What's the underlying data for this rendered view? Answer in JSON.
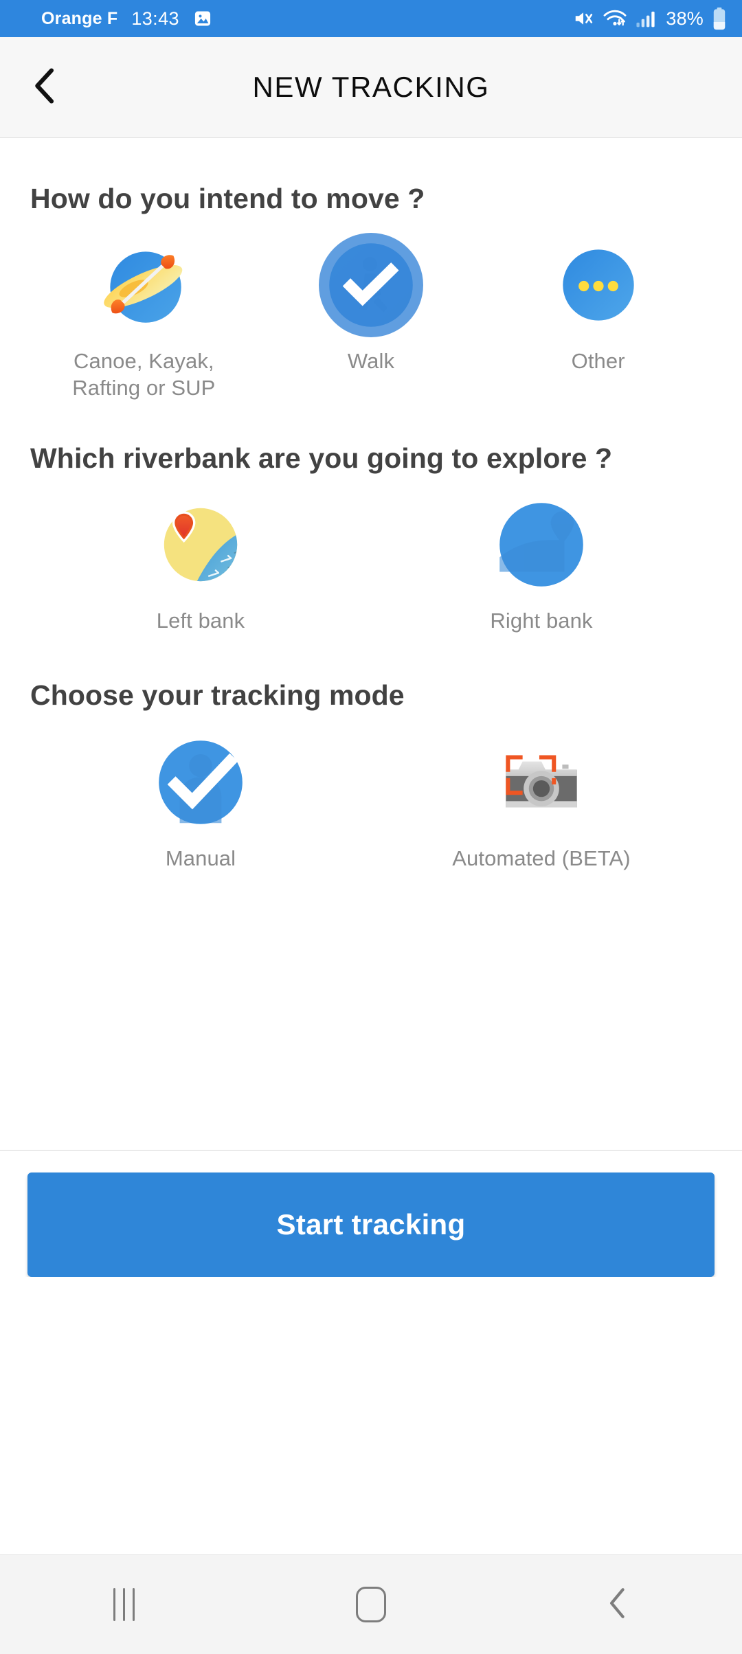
{
  "status_bar": {
    "carrier": "Orange F",
    "time": "13:43",
    "battery_percent": "38%",
    "icons": [
      "screenshot-image-icon",
      "mute-icon",
      "wifi-icon",
      "cellular-signal-icon",
      "battery-icon"
    ],
    "background_color": "#2e86de"
  },
  "appbar": {
    "title": "NEW TRACKING",
    "back_icon": "chevron-left-icon",
    "background_color": "#f7f7f7"
  },
  "sections": {
    "move": {
      "title": "How do you intend to move ?",
      "options": [
        {
          "label": "Canoe, Kayak, Rafting or SUP",
          "icon": "kayak-icon",
          "selected": false
        },
        {
          "label": "Walk",
          "icon": "walk-icon",
          "selected": true
        },
        {
          "label": "Other",
          "icon": "other-dots-icon",
          "selected": false
        }
      ]
    },
    "riverbank": {
      "title": "Which riverbank are you going to explore ?",
      "options": [
        {
          "label": "Left bank",
          "icon": "left-bank-map-pin-icon",
          "selected": false
        },
        {
          "label": "Right bank",
          "icon": "right-bank-map-pin-icon",
          "selected": true
        }
      ]
    },
    "tracking_mode": {
      "title": "Choose your tracking mode",
      "options": [
        {
          "label": "Manual",
          "icon": "manual-pin-icon",
          "selected": true
        },
        {
          "label": "Automated (BETA)",
          "icon": "camera-icon",
          "selected": false
        }
      ]
    }
  },
  "footer": {
    "start_button_label": "Start tracking",
    "accent_color": "#2f86d8"
  },
  "navbar": {
    "recents_label": "recents-icon",
    "home_label": "home-icon",
    "back_label": "back-icon"
  }
}
